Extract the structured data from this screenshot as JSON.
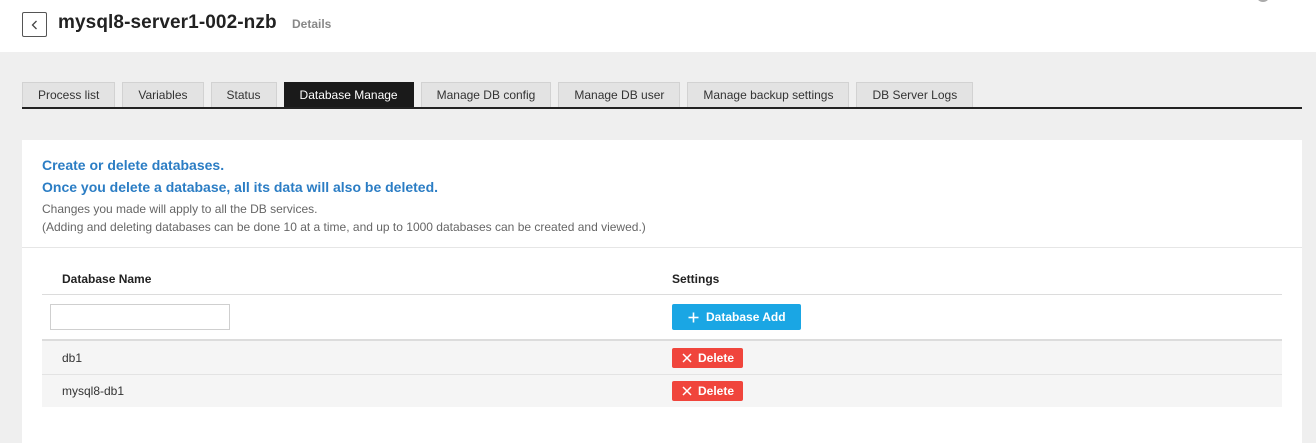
{
  "header": {
    "title": "mysql8-server1-002-nzb",
    "subtitle": "Details"
  },
  "tabs": [
    {
      "label": "Process list",
      "active": false
    },
    {
      "label": "Variables",
      "active": false
    },
    {
      "label": "Status",
      "active": false
    },
    {
      "label": "Database Manage",
      "active": true
    },
    {
      "label": "Manage DB config",
      "active": false
    },
    {
      "label": "Manage DB user",
      "active": false
    },
    {
      "label": "Manage backup settings",
      "active": false
    },
    {
      "label": "DB Server Logs",
      "active": false
    }
  ],
  "info": {
    "line1": "Create or delete databases.",
    "line2": "Once you delete a database, all its data will also be deleted.",
    "note1": "Changes you made will apply to all the DB services.",
    "note2": "(Adding and deleting databases can be done 10 at a time, and up to 1000 databases can be created and viewed.)"
  },
  "table": {
    "col_name": "Database Name",
    "col_settings": "Settings",
    "input_value": "",
    "add_label": "Database Add",
    "delete_label": "Delete",
    "rows": [
      {
        "name": "db1"
      },
      {
        "name": "mysql8-db1"
      }
    ]
  },
  "colors": {
    "accent_blue": "#2b7dc4",
    "add_button": "#1aa6e4",
    "delete_button": "#f0453c",
    "active_tab": "#1a1a1a"
  }
}
